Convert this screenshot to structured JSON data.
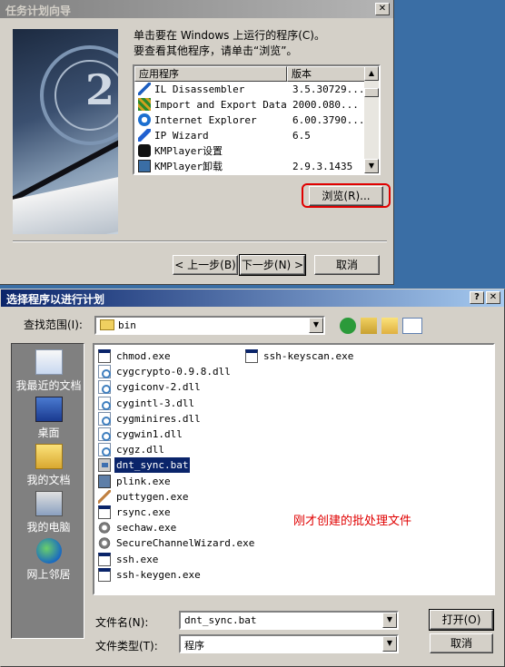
{
  "wizard": {
    "title": "任务计划向导",
    "instruction_line1": "单击要在 Windows 上运行的程序(C)。",
    "instruction_line2": "要查看其他程序，请单击“浏览”。",
    "list": {
      "columns": [
        "应用程序",
        "版本"
      ],
      "items": [
        {
          "name": "IL Disassembler",
          "version": "3.5.30729..."
        },
        {
          "name": "Import and Export Data",
          "version": "2000.080..."
        },
        {
          "name": "Internet Explorer",
          "version": "6.00.3790..."
        },
        {
          "name": "IP Wizard",
          "version": "6.5"
        },
        {
          "name": "KMPlayer设置",
          "version": ""
        },
        {
          "name": "KMPlayer卸载",
          "version": "2.9.3.1435"
        }
      ]
    },
    "browse_label": "浏览(R)...",
    "back_label": "< 上一步(B)",
    "next_label": "下一步(N) >",
    "cancel_label": "取消"
  },
  "dialog": {
    "title": "选择程序以进行计划",
    "look_in_label": "查找范围(I):",
    "look_in_value": "bin",
    "places": [
      "我最近的文档",
      "桌面",
      "我的文档",
      "我的电脑",
      "网上邻居"
    ],
    "files_col1": [
      {
        "name": "chmod.exe",
        "icon": "exe"
      },
      {
        "name": "cygcrypto-0.9.8.dll",
        "icon": "dll"
      },
      {
        "name": "cygiconv-2.dll",
        "icon": "dll"
      },
      {
        "name": "cygintl-3.dll",
        "icon": "dll"
      },
      {
        "name": "cygminires.dll",
        "icon": "dll"
      },
      {
        "name": "cygwin1.dll",
        "icon": "dll"
      },
      {
        "name": "cygz.dll",
        "icon": "dll"
      },
      {
        "name": "dnt_sync.bat",
        "icon": "bat",
        "selected": true
      },
      {
        "name": "plink.exe",
        "icon": "pc"
      },
      {
        "name": "puttygen.exe",
        "icon": "key"
      },
      {
        "name": "rsync.exe",
        "icon": "exe"
      },
      {
        "name": "sechaw.exe",
        "icon": "gear"
      },
      {
        "name": "SecureChannelWizard.exe",
        "icon": "gear"
      },
      {
        "name": "ssh.exe",
        "icon": "exe"
      },
      {
        "name": "ssh-keygen.exe",
        "icon": "exe"
      }
    ],
    "files_col2": [
      {
        "name": "ssh-keyscan.exe",
        "icon": "exe"
      }
    ],
    "annotation": "刚才创建的批处理文件",
    "filename_label": "文件名(N):",
    "filename_value": "dnt_sync.bat",
    "filetype_label": "文件类型(T):",
    "filetype_value": "程序",
    "open_label": "打开(O)",
    "cancel_label": "取消",
    "help_label": "?",
    "close_label": "✕"
  },
  "colors": {
    "active_title": "#0a246a",
    "face": "#d4d0c8",
    "annotation": "#e00000"
  }
}
